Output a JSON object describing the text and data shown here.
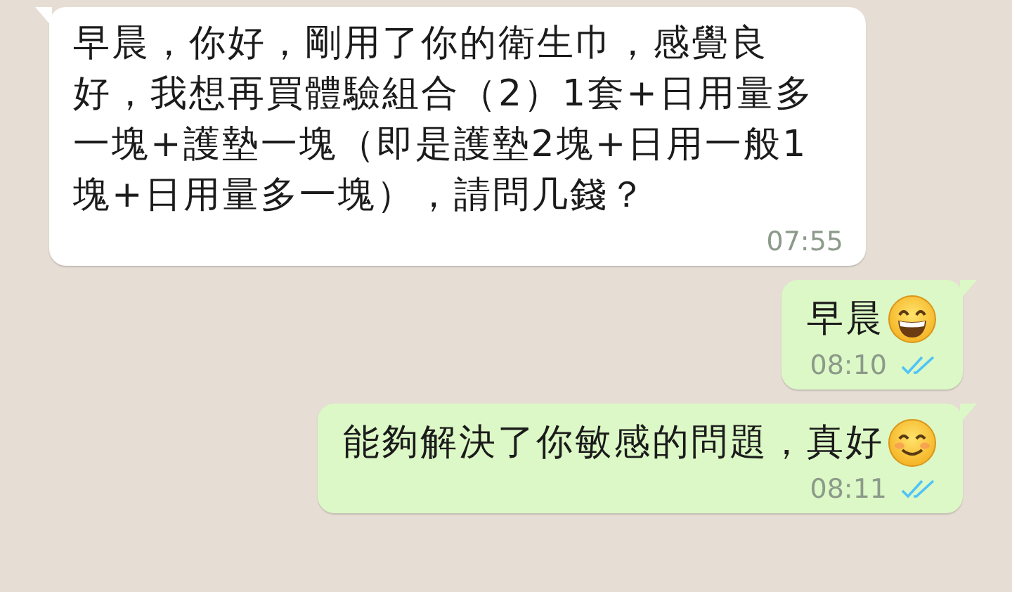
{
  "messages": [
    {
      "kind": "incoming",
      "text": "早晨，你好，剛用了你的衛生巾，感覺良好，我想再買體驗組合（2）1套+日用量多一塊+護墊一塊（即是護墊2塊+日用一般1塊+日用量多一塊），請問几錢？",
      "time": "07:55"
    },
    {
      "kind": "outgoing",
      "text": "早晨",
      "emoji": {
        "kind": "grinning"
      },
      "time": "08:10",
      "read": true
    },
    {
      "kind": "outgoing",
      "text": "能夠解決了你敏感的問題，真好",
      "emoji": {
        "kind": "smiling"
      },
      "time": "08:11",
      "read": true
    }
  ]
}
